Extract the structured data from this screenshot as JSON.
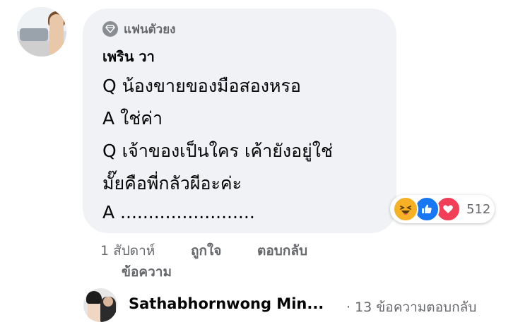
{
  "comment": {
    "badge": {
      "icon": "diamond-icon",
      "label": "แฟนตัวยง"
    },
    "author": "เพริน วา",
    "lines": [
      "Q น้องขายของมือสองหรอ",
      "A ใช่ค่า",
      "Q เจ้าของเป็นใคร เค้ายังอยู่ใช่",
      "มั๊ยคือพี่กลัวผีอะค่ะ",
      "A ........................"
    ],
    "reactions": {
      "icons": [
        "haha-icon",
        "like-icon",
        "love-icon"
      ],
      "count": "512"
    },
    "actions": {
      "time": "1 สัปดาห์",
      "like": "ถูกใจ",
      "reply": "ตอบกลับ",
      "message": "ข้อความ"
    }
  },
  "reply_preview": {
    "name": "Sathabhornwong Min...",
    "meta": "· 13 ข้อความตอบกลับ"
  },
  "colors": {
    "bubble": "#f0f2f5",
    "secondary_text": "#65676b",
    "like": "#1877f2",
    "love": "#f33e58",
    "haha": "#f7b125"
  }
}
